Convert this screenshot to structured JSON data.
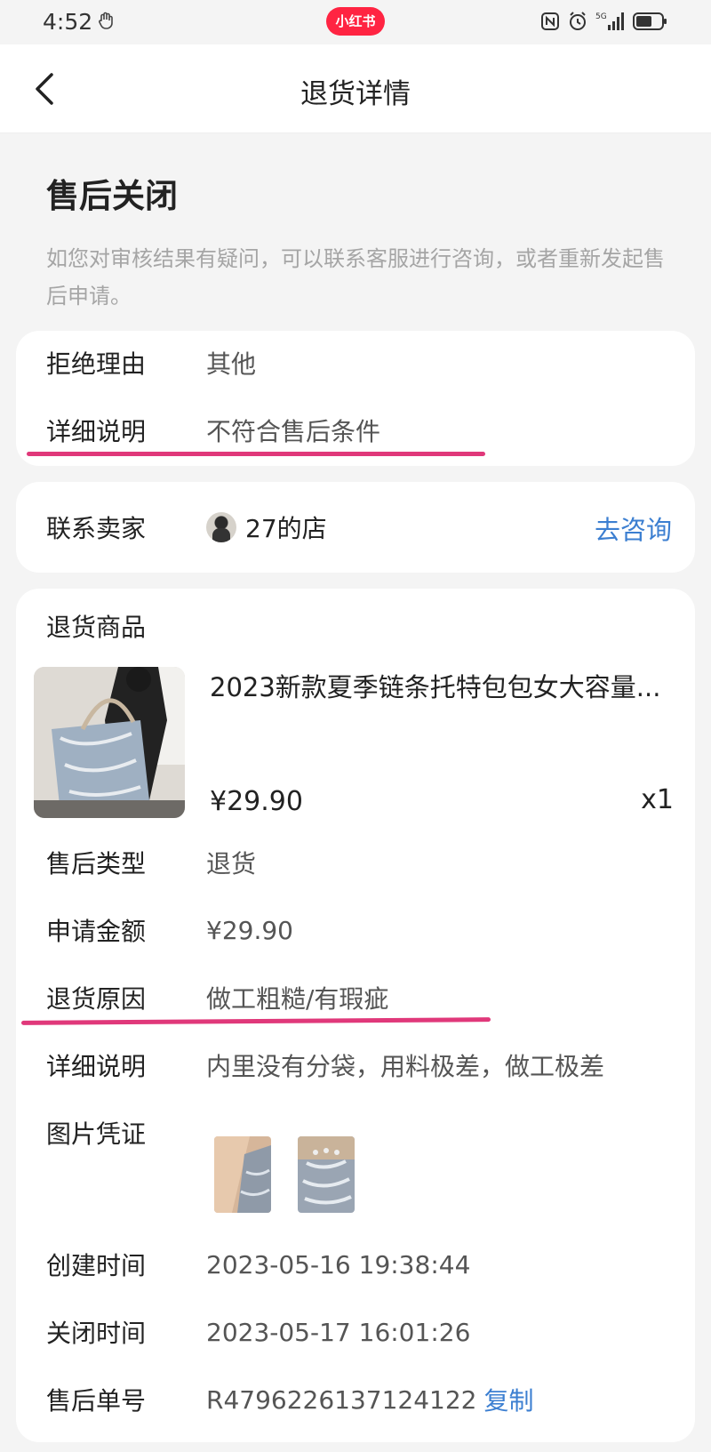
{
  "status_bar": {
    "time": "4:52",
    "app_badge": "小红书"
  },
  "nav": {
    "title": "退货详情"
  },
  "header": {
    "status_title": "售后关闭",
    "description": "如您对审核结果有疑问，可以联系客服进行咨询，或者重新发起售后申请。"
  },
  "rejection": {
    "reason_label": "拒绝理由",
    "reason_value": "其他",
    "detail_label": "详细说明",
    "detail_value": "不符合售后条件"
  },
  "seller": {
    "label": "联系卖家",
    "name": "27的店",
    "consult_label": "去咨询"
  },
  "product": {
    "section_label": "退货商品",
    "title": "2023新款夏季链条托特包包女大容量...",
    "price": "¥29.90",
    "quantity": "x1"
  },
  "details": {
    "type_label": "售后类型",
    "type_value": "退货",
    "amount_label": "申请金额",
    "amount_value": "¥29.90",
    "reason_label": "退货原因",
    "reason_value": "做工粗糙/有瑕疵",
    "desc_label": "详细说明",
    "desc_value": "内里没有分袋，用料极差，做工极差",
    "photos_label": "图片凭证",
    "created_label": "创建时间",
    "created_value": "2023-05-16 19:38:44",
    "closed_label": "关闭时间",
    "closed_value": "2023-05-17 16:01:26",
    "order_label": "售后单号",
    "order_value": "R4796226137124122",
    "copy_label": "复制"
  },
  "colors": {
    "accent_link": "#3c7fd1",
    "highlight_underline": "#e0387a",
    "brand": "#ff2442"
  }
}
